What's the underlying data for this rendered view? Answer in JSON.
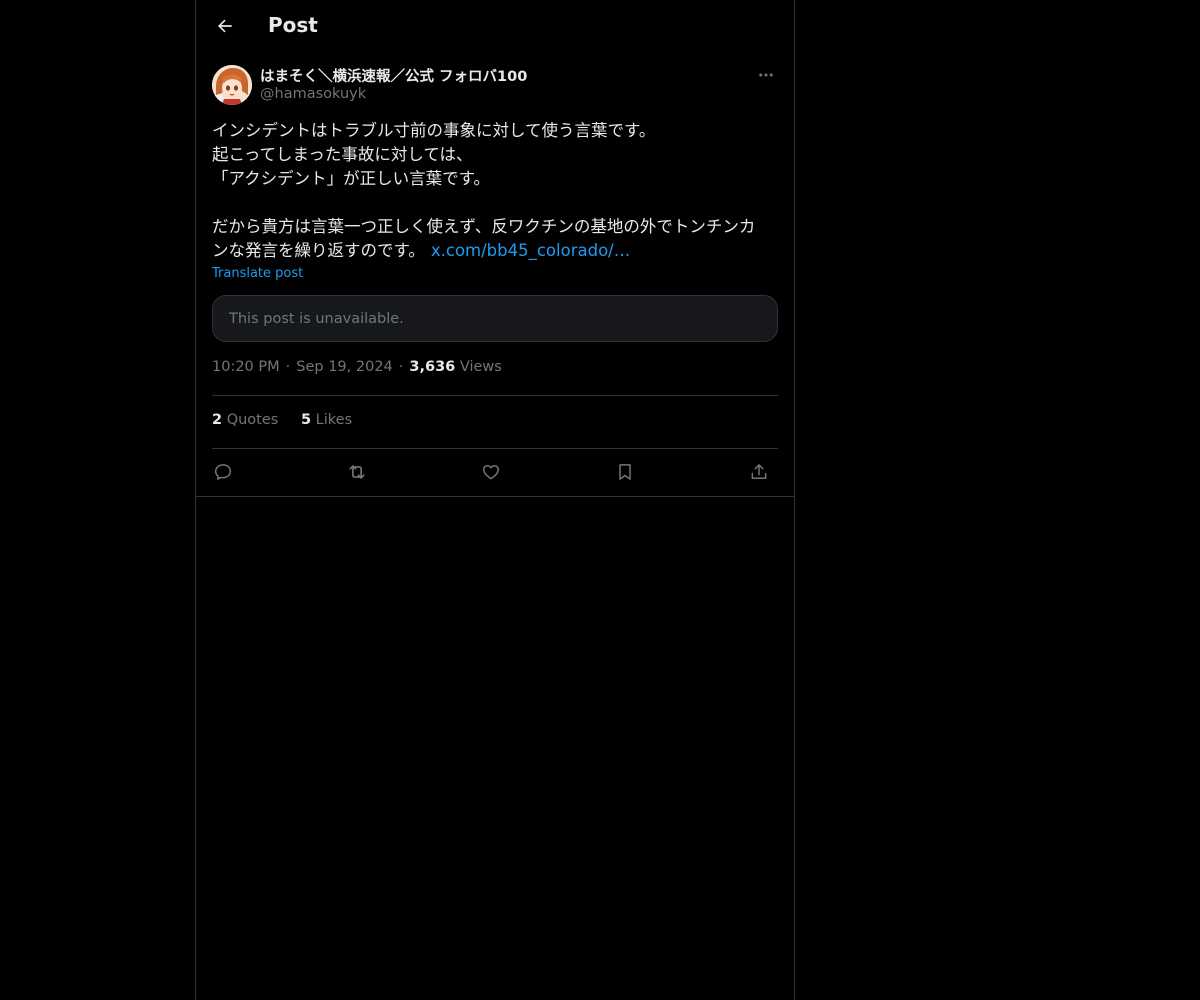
{
  "header": {
    "title": "Post"
  },
  "author": {
    "display_name": "はまそく＼横浜速報／公式 フォロバ100",
    "handle": "@hamasokuyk"
  },
  "post": {
    "lines": [
      "インシデントはトラブル寸前の事象に対して使う言葉です。",
      "起こってしまった事故に対しては、",
      "「アクシデント」が正しい言葉です。",
      "",
      "だから貴方は言葉一つ正しく使えず、反ワクチンの基地の外でトンチンカ",
      "ンな発言を繰り返すのです。"
    ],
    "link": "x.com/bb45_colorado/…",
    "translate_label": "Translate post",
    "quoted_unavailable": "This post is unavailable."
  },
  "meta": {
    "time": "10:20 PM",
    "separator": "·",
    "date": "Sep 19, 2024",
    "views_count": "3,636",
    "views_label": "Views"
  },
  "stats": {
    "quotes_count": "2",
    "quotes_label": "Quotes",
    "likes_count": "5",
    "likes_label": "Likes"
  },
  "actions": [
    "reply-icon",
    "repost-icon",
    "like-icon",
    "bookmark-icon",
    "share-icon"
  ],
  "colors": {
    "background": "#000000",
    "text": "#e7e9ea",
    "muted": "#71767b",
    "accent": "#1d9bf0",
    "border": "#2f3336"
  }
}
